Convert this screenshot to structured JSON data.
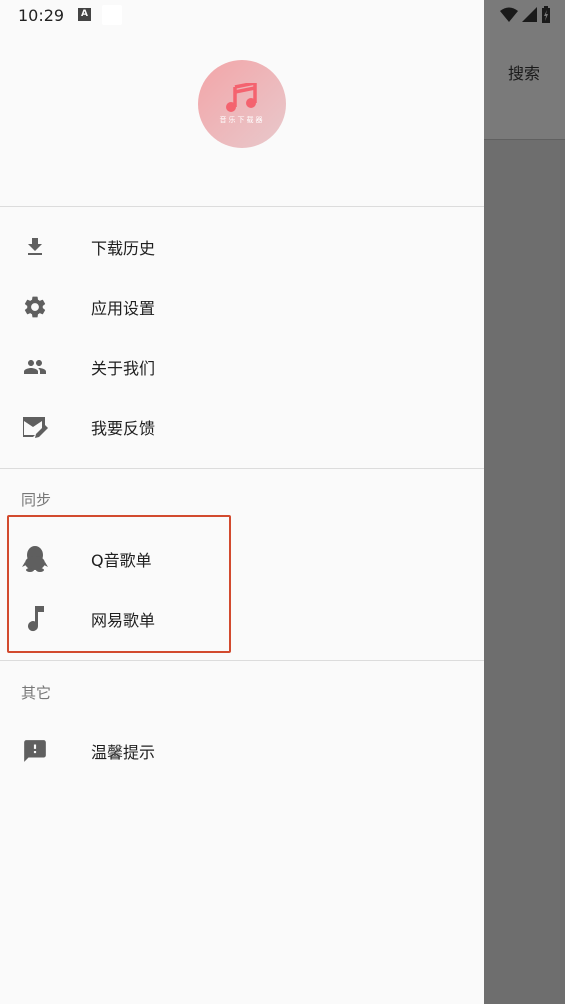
{
  "status": {
    "time": "10:29",
    "a_icon": "A"
  },
  "background": {
    "search_label": "搜索"
  },
  "logo": {
    "caption": "音乐下载器"
  },
  "menu": [
    {
      "label": "下载历史",
      "icon": "download-icon"
    },
    {
      "label": "应用设置",
      "icon": "gear-icon"
    },
    {
      "label": "关于我们",
      "icon": "people-icon"
    },
    {
      "label": "我要反馈",
      "icon": "feedback-mail-icon"
    }
  ],
  "sync_section": {
    "title": "同步",
    "items": [
      {
        "label": "Q音歌单",
        "icon": "qq-penguin-icon"
      },
      {
        "label": "网易歌单",
        "icon": "music-note-icon"
      }
    ]
  },
  "other_section": {
    "title": "其它",
    "items": [
      {
        "label": "温馨提示",
        "icon": "alert-message-icon"
      }
    ]
  },
  "colors": {
    "highlight": "#d24a2e",
    "icon": "#5f5f5f",
    "drawer_bg": "#fafafa"
  }
}
